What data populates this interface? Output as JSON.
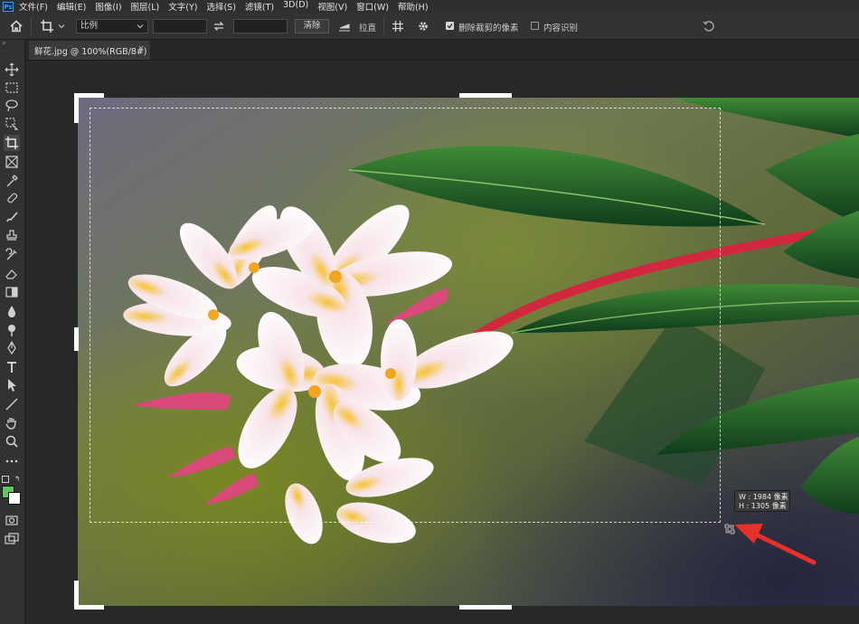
{
  "app": {
    "logo_text": "Ps"
  },
  "menu": [
    "文件(F)",
    "编辑(E)",
    "图像(I)",
    "图层(L)",
    "文字(Y)",
    "选择(S)",
    "滤镜(T)",
    "3D(D)",
    "视图(V)",
    "窗口(W)",
    "帮助(H)"
  ],
  "options_bar": {
    "ratio_select": "比例",
    "width_value": "",
    "height_value": "",
    "clear_label": "清除",
    "straighten_label": "拉直",
    "delete_cropped_label": "删除裁剪的像素",
    "delete_cropped_checked": true,
    "content_aware_label": "内容识别",
    "content_aware_checked": false
  },
  "document_tab": {
    "title": "鲜花.jpg @ 100%(RGB/8#)",
    "close": "×"
  },
  "toolbar": {
    "tools": [
      "move-tool",
      "marquee-tool",
      "lasso-tool",
      "object-select-tool",
      "crop-tool",
      "frame-tool",
      "eyedropper-tool",
      "healing-brush-tool",
      "brush-tool",
      "clone-stamp-tool",
      "history-brush-tool",
      "eraser-tool",
      "gradient-tool",
      "blur-tool",
      "dodge-tool",
      "pen-tool",
      "type-tool",
      "path-select-tool",
      "line-tool",
      "hand-tool",
      "zoom-tool",
      "more-tools"
    ],
    "foreground_color": "#5ec95a",
    "background_color": "#ffffff"
  },
  "crop_tooltip": {
    "width_line": "W : 1984 像素",
    "height_line": "H : 1305 像素"
  },
  "colors": {
    "annotation_arrow": "#e8302a",
    "accent": "#31a8ff"
  }
}
